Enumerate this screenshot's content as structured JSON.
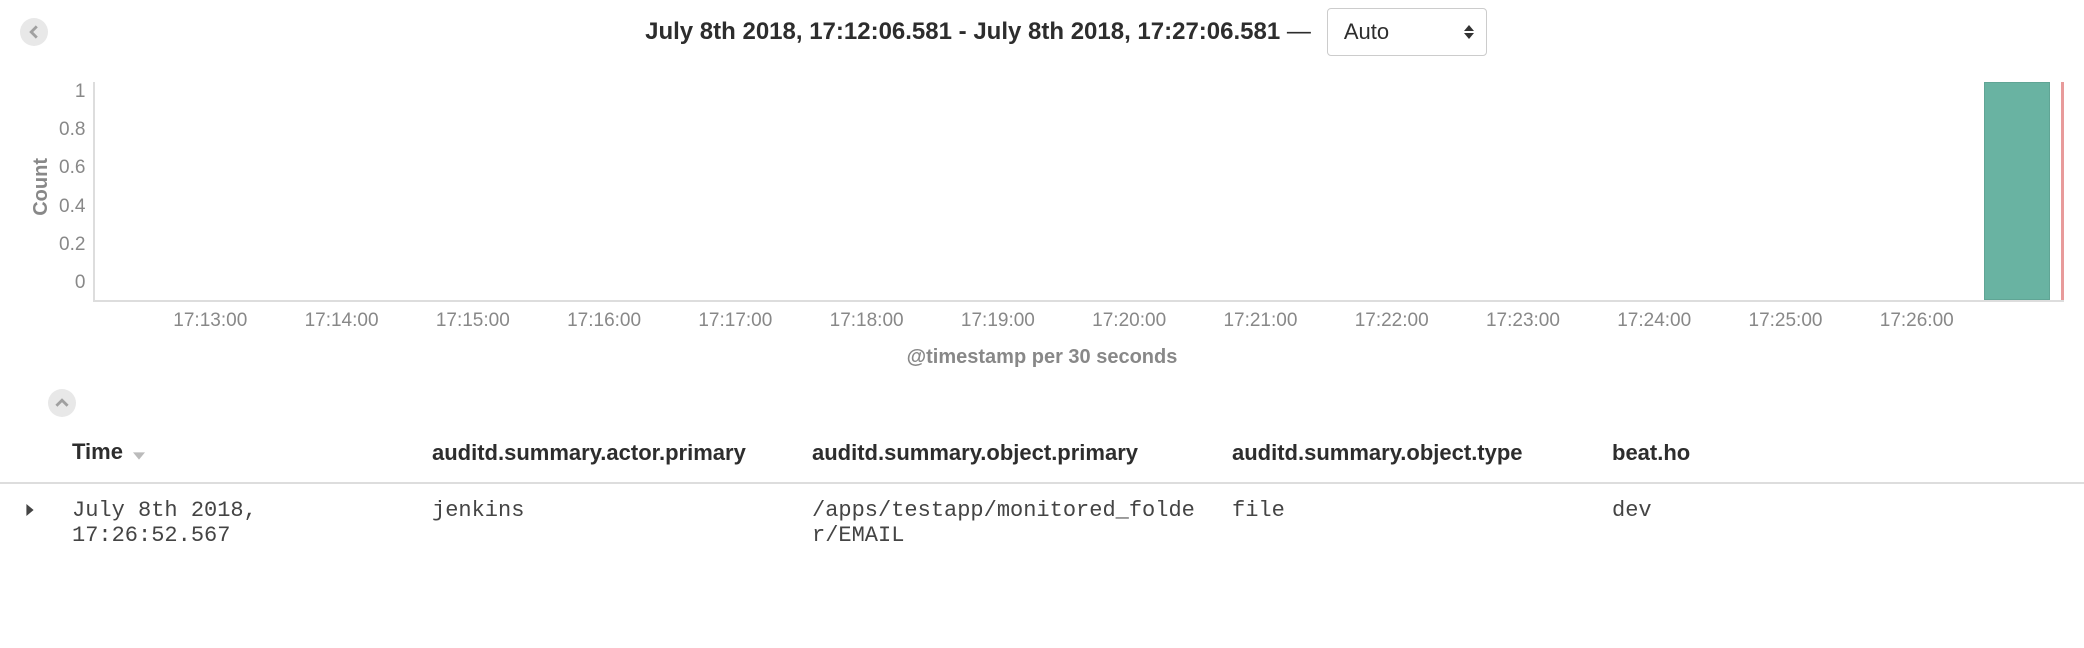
{
  "header": {
    "time_from": "July 8th 2018, 17:12:06.581",
    "time_to": "July 8th 2018, 17:27:06.581",
    "interval_selected": "Auto"
  },
  "chart_data": {
    "type": "bar",
    "title": "",
    "xlabel": "@timestamp per 30 seconds",
    "ylabel": "Count",
    "ylim": [
      0,
      1
    ],
    "y_ticks": [
      "1",
      "0.8",
      "0.6",
      "0.4",
      "0.2",
      "0"
    ],
    "x_ticks": [
      "17:13:00",
      "17:14:00",
      "17:15:00",
      "17:16:00",
      "17:17:00",
      "17:18:00",
      "17:19:00",
      "17:20:00",
      "17:21:00",
      "17:22:00",
      "17:23:00",
      "17:24:00",
      "17:25:00",
      "17:26:00"
    ],
    "x_range": [
      "17:12:06.581",
      "17:27:06.581"
    ],
    "series": [
      {
        "name": "Count",
        "color": "#69b3a2",
        "data": [
          {
            "x": "17:26:30",
            "y": 1
          }
        ]
      }
    ],
    "marker_x": "17:27:06.581"
  },
  "table": {
    "columns": {
      "time": "Time",
      "actor": "auditd.summary.actor.primary",
      "object": "auditd.summary.object.primary",
      "type": "auditd.summary.object.type",
      "host": "beat.ho"
    },
    "rows": [
      {
        "time": "July 8th 2018, 17:26:52.567",
        "actor": "jenkins",
        "object": "/apps/testapp/monitored_folder/EMAIL",
        "type": "file",
        "host": "dev"
      }
    ]
  }
}
